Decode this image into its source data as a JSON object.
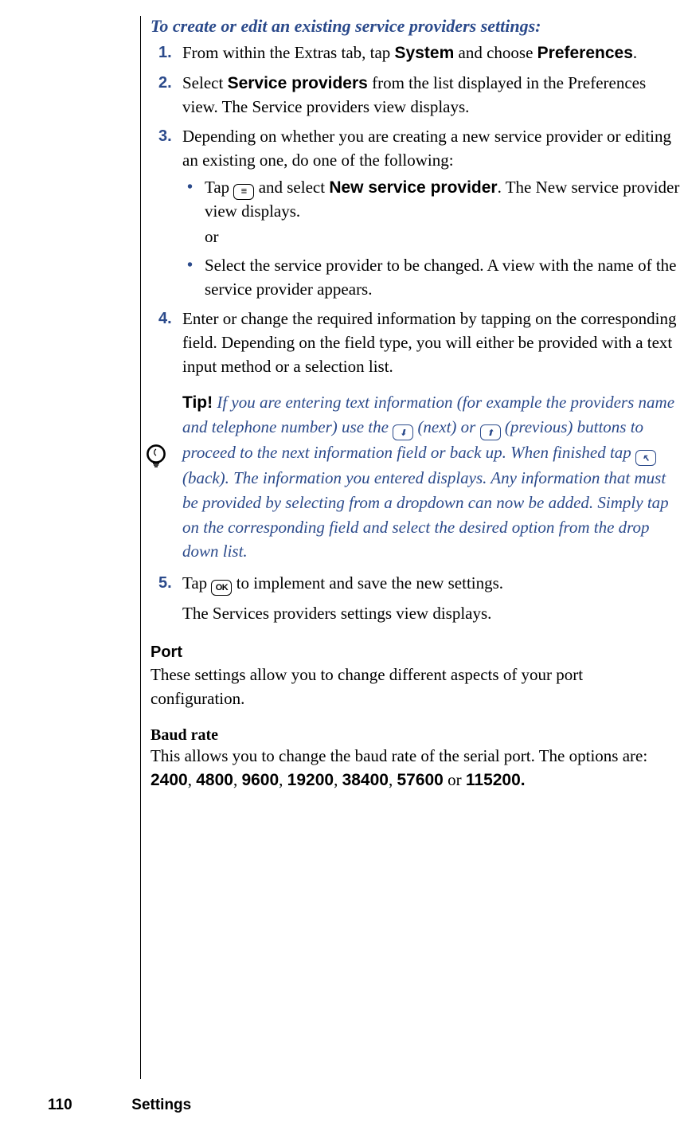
{
  "heading": "To create or edit an existing service providers settings:",
  "steps": [
    {
      "segments": [
        {
          "t": "From within the Extras tab, tap "
        },
        {
          "t": "System",
          "bold": true
        },
        {
          "t": " and choose "
        },
        {
          "t": "Preferences",
          "bold": true
        },
        {
          "t": "."
        }
      ]
    },
    {
      "segments": [
        {
          "t": "Select "
        },
        {
          "t": "Service providers",
          "bold": true
        },
        {
          "t": " from the list displayed in the Preferences view. The Service providers view displays."
        }
      ]
    },
    {
      "segments": [
        {
          "t": "Depending on whether you are creating a new service provider or editing an existing one, do one of the following:"
        }
      ],
      "bullets": [
        {
          "segments": [
            {
              "t": "Tap "
            },
            {
              "icon": "menu"
            },
            {
              "t": " and select "
            },
            {
              "t": "New service provider",
              "bold": true
            },
            {
              "t": ". The New service provider view displays."
            }
          ],
          "trailer": "or"
        },
        {
          "segments": [
            {
              "t": "Select the service provider to be changed. A view with the name of the service provider appears."
            }
          ]
        }
      ]
    },
    {
      "segments": [
        {
          "t": "Enter or change the required information by tapping on the corresponding field. Depending on the field type, you will either be provided with a text input method or a selection list."
        }
      ]
    },
    {
      "segments": [
        {
          "t": "Tap "
        },
        {
          "icon": "ok"
        },
        {
          "t": " to implement and save the new settings."
        }
      ],
      "after": "The Services providers settings view displays."
    }
  ],
  "tip_after_step_index": 3,
  "tip": {
    "label": "Tip!",
    "segments": [
      {
        "t": " If you are entering text information (for example the providers name and telephone number) use the "
      },
      {
        "arrow": "next"
      },
      {
        "t": " (next) or "
      },
      {
        "arrow": "prev"
      },
      {
        "t": " (previous) buttons to proceed to the next information field or back up. When finished tap "
      },
      {
        "arrow": "back"
      },
      {
        "t": " (back). The information you entered displays. Any information that must be provided by selecting from a dropdown can now be added. Simply tap on the corresponding field and select the desired option from the drop down list."
      }
    ]
  },
  "port": {
    "heading": "Port",
    "body": "These settings allow you to change different aspects of your port configuration."
  },
  "baud": {
    "heading": "Baud rate",
    "intro": "This allows you to change the baud rate of the serial port. The options are: ",
    "values": [
      "2400",
      "4800",
      "9600",
      "19200",
      "38400",
      "57600"
    ],
    "last_value": "115200.",
    "sep": ", ",
    "or_word": " or "
  },
  "footer": {
    "page": "110",
    "section": "Settings"
  },
  "icon_ok_text": "OK"
}
